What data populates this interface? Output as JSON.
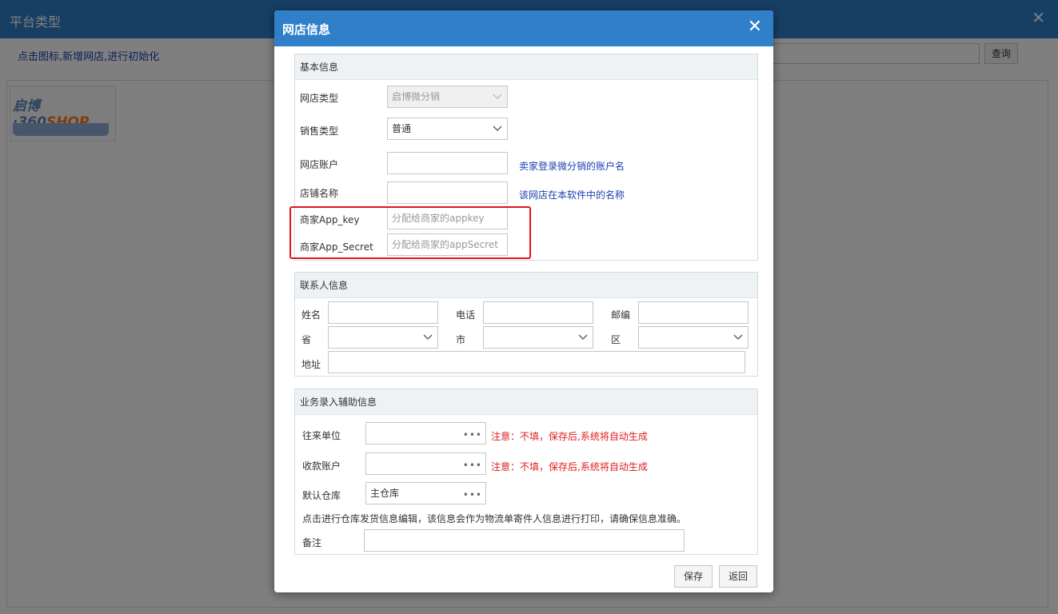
{
  "background": {
    "title": "平台类型",
    "hint": "点击图标,新增网店,进行初始化",
    "query_label": "查询",
    "tile": {
      "logo_prefix": "启博·360",
      "logo_suffix": "SHOP"
    }
  },
  "dialog": {
    "title": "网店信息",
    "basic": {
      "header": "基本信息",
      "shop_type_label": "网店类型",
      "shop_type_value": "启博微分销",
      "sale_type_label": "销售类型",
      "sale_type_value": "普通",
      "account_label": "网店账户",
      "account_value": "",
      "account_note": "卖家登录微分销的账户名",
      "shop_name_label": "店铺名称",
      "shop_name_value": "",
      "shop_name_note": "该网店在本软件中的名称",
      "app_key_label": "商家App_key",
      "app_key_placeholder": "分配给商家的appkey",
      "app_secret_label": "商家App_Secret",
      "app_secret_placeholder": "分配给商家的appSecret"
    },
    "contact": {
      "header": "联系人信息",
      "name_label": "姓名",
      "phone_label": "电话",
      "zip_label": "邮编",
      "province_label": "省",
      "city_label": "市",
      "district_label": "区",
      "address_label": "地址"
    },
    "business": {
      "header": "业务录入辅助信息",
      "partner_label": "往来单位",
      "partner_value": "",
      "partner_note": "注意：不填，保存后,系统将自动生成",
      "receipt_label": "收款账户",
      "receipt_value": "",
      "receipt_note": "注意：不填，保存后,系统将自动生成",
      "warehouse_label": "默认仓库",
      "warehouse_value": "主仓库",
      "warehouse_hint": "点击进行仓库发货信息编辑，该信息会作为物流单寄件人信息进行打印，请确保信息准确。",
      "remark_label": "备注",
      "remark_value": ""
    },
    "buttons": {
      "save": "保存",
      "back": "返回"
    }
  }
}
